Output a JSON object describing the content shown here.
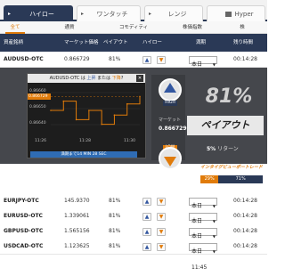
{
  "tabs": [
    {
      "label": "ハイロー"
    },
    {
      "label": "ワンタッチ"
    },
    {
      "label": "レンジ"
    },
    {
      "label": "Hyper"
    }
  ],
  "subtabs": [
    "全て",
    "通貨",
    "コモディティ",
    "株価指数",
    "株"
  ],
  "header": {
    "asset": "資産銘柄",
    "price": "マーケット価格",
    "payout": "ペイアウト",
    "highlow": "ハイロー",
    "expiry": "満期",
    "time_left": "残り時間"
  },
  "rows": [
    {
      "asset": "AUDUSD-OTC",
      "price": "0.866729",
      "payout": "81%",
      "expiry": "本日 11:45",
      "time_left": "00:14:28"
    },
    {
      "asset": "EURJPY-OTC",
      "price": "145.9370",
      "payout": "81%",
      "expiry": "本日 11:45",
      "time_left": "00:14:28"
    },
    {
      "asset": "EURUSD-OTC",
      "price": "1.339061",
      "payout": "81%",
      "expiry": "本日 11:45",
      "time_left": "00:14:28"
    },
    {
      "asset": "GBPUSD-OTC",
      "price": "1.565156",
      "payout": "81%",
      "expiry": "本日 11:45",
      "time_left": "00:14:28"
    },
    {
      "asset": "USDCAD-OTC",
      "price": "1.123625",
      "payout": "81%",
      "expiry": "本日 11:45",
      "time_left": "00:14:28"
    }
  ],
  "chart": {
    "title_prefix": "AUDUSD-OTC は",
    "title_high": "上昇",
    "title_mid": "または",
    "title_low": "下降",
    "title_suffix": "?",
    "close_icon": "close-icon",
    "y_ticks": [
      "0.86660",
      "0.86650",
      "0.86640"
    ],
    "x_ticks": [
      "11:26",
      "11:28",
      "11:30"
    ],
    "current_price": "0.866729",
    "expiry_text": "満期まで14 MIN 28 SEC",
    "chart_data": {
      "type": "line",
      "x": [
        "11:24",
        "11:25",
        "11:26",
        "11:27",
        "11:28",
        "11:29",
        "11:30",
        "11:31"
      ],
      "series": [
        {
          "values": [
            0.86655,
            0.86665,
            0.86645,
            0.86655,
            0.8664,
            0.8665,
            0.86662,
            0.8667
          ]
        }
      ],
      "ylim": [
        0.8663,
        0.8668
      ]
    }
  },
  "trade": {
    "high_label": "HIGH",
    "low_label": "LOW",
    "market_label": "マーケット",
    "market_value": "0.866729",
    "payout_pct": "81%",
    "payout_label": "ペイアウト",
    "return_pct": "5%",
    "return_label": "リターン",
    "trader_label": "インタイグビューポートレード",
    "sentiment_left": "29%",
    "sentiment_right": "71%",
    "sentiment_left_value": 0.29
  },
  "colors": {
    "navy": "#2a3956",
    "orange": "#e07b0a",
    "blue": "#3357a0"
  }
}
